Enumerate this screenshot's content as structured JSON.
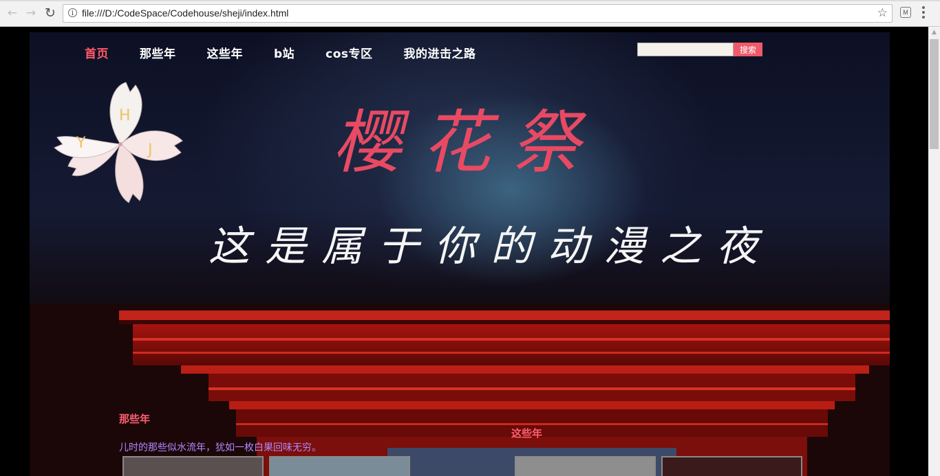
{
  "browser": {
    "url": "file:///D:/CodeSpace/Codehouse/sheji/index.html",
    "icons": [
      "back-arrow-icon",
      "forward-arrow-icon",
      "reload-icon",
      "info-icon",
      "bookmark-star-icon",
      "extension-icon",
      "menu-icon"
    ]
  },
  "nav": {
    "items": [
      {
        "label": "首页"
      },
      {
        "label": "那些年"
      },
      {
        "label": "这些年"
      },
      {
        "label": "b站"
      },
      {
        "label": "cos专区"
      },
      {
        "label": "我的进击之路"
      }
    ],
    "active": 0
  },
  "search": {
    "placeholder": "",
    "button_label": "搜索"
  },
  "hero": {
    "title": "樱花祭",
    "subtitle": "这是属于你的动漫之夜",
    "logo_letters": [
      "H",
      "Y",
      "J"
    ]
  },
  "sections": {
    "left_title": "那些年",
    "left_desc": "儿时的那些似水流年，犹如一枚白果回味无穷。",
    "right_title": "这些年"
  },
  "colors": {
    "accent": "#ff5a6a",
    "title": "#e84a63",
    "desc": "#b388ff",
    "search_button": "#ef5a6a"
  }
}
